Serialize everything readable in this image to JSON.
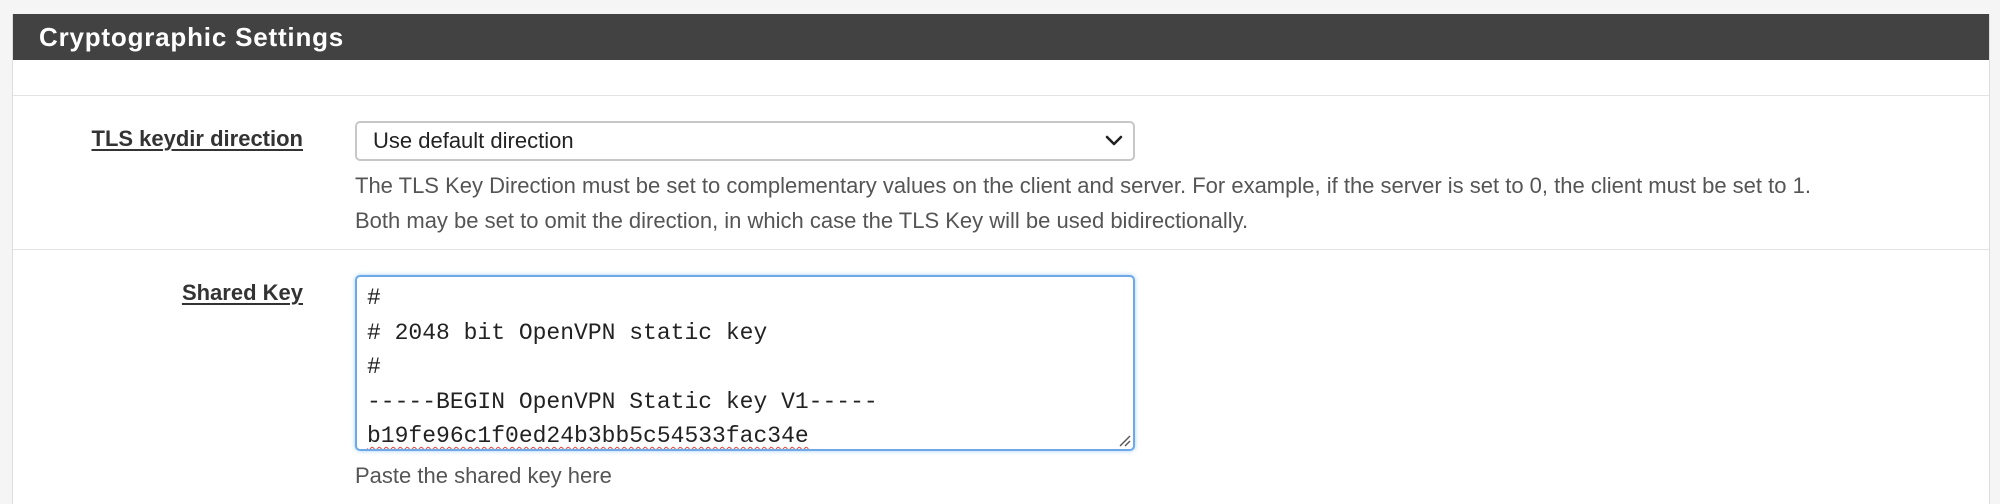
{
  "panel": {
    "title": "Cryptographic Settings"
  },
  "tls_keydir": {
    "label": "TLS keydir direction",
    "selected": "Use default direction",
    "help_line1": "The TLS Key Direction must be set to complementary values on the client and server. For example, if the server is set to 0, the client must be set to 1.",
    "help_line2": "Both may be set to omit the direction, in which case the TLS Key will be used bidirectionally."
  },
  "shared_key": {
    "label": "Shared Key",
    "lines": [
      "#",
      "# 2048 bit OpenVPN static key",
      "#",
      "-----BEGIN OpenVPN Static key V1-----",
      "b19fe96c1f0ed24b3bb5c54533fac34e"
    ],
    "help": "Paste the shared key here"
  },
  "icons": {
    "select_arrow": "chevron-down-icon",
    "textarea_resize": "resize-grip-icon"
  },
  "colors": {
    "heading_bg": "#424242",
    "focus_border": "#6ea8e8"
  }
}
